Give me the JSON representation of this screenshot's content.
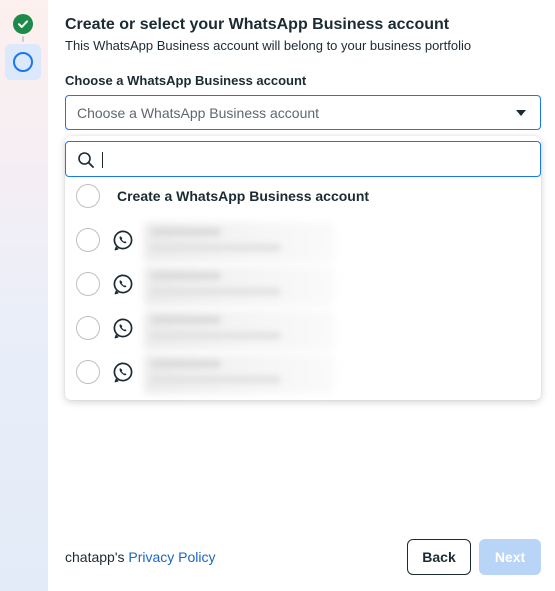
{
  "header": {
    "title": "Create or select your WhatsApp Business account",
    "subtitle": "This WhatsApp Business account will belong to your business portfolio"
  },
  "stepper": {
    "steps": [
      {
        "status": "completed",
        "icon": "check-icon"
      },
      {
        "status": "current",
        "icon": "circle-icon"
      }
    ]
  },
  "field": {
    "label": "Choose a WhatsApp Business account",
    "placeholder": "Choose a WhatsApp Business account"
  },
  "dropdown": {
    "search_value": "",
    "search_icon": "search-icon",
    "create_option_label": "Create a WhatsApp Business account",
    "accounts": [
      {
        "icon": "whatsapp-icon",
        "redacted": true
      },
      {
        "icon": "whatsapp-icon",
        "redacted": true
      },
      {
        "icon": "whatsapp-icon",
        "redacted": true
      },
      {
        "icon": "whatsapp-icon",
        "redacted": true
      }
    ]
  },
  "footer": {
    "prefix": "chatapp's ",
    "privacy_link": "Privacy Policy",
    "back_label": "Back",
    "next_label": "Next"
  },
  "colors": {
    "accent": "#1877f2",
    "success": "#1d8a4a",
    "next_disabled": "#b8d5f8",
    "link": "#1b65c4"
  }
}
